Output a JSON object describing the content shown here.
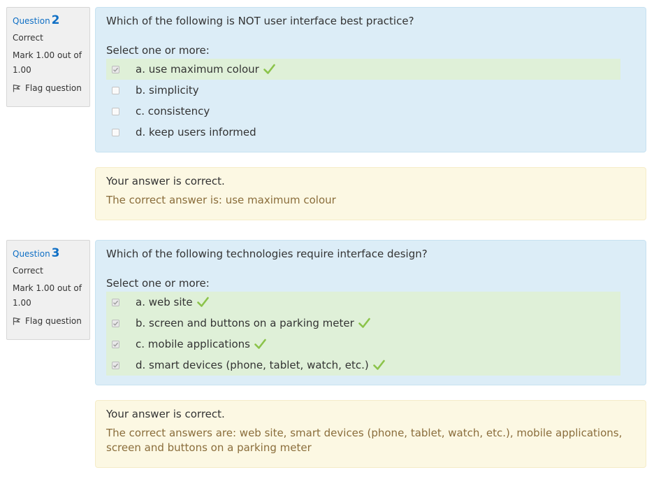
{
  "questions": [
    {
      "label": "Question",
      "number": "2",
      "state": "Correct",
      "grade": "Mark 1.00 out of 1.00",
      "flag_label": "Flag question",
      "text": "Which of the following is NOT user interface best practice?",
      "prompt": "Select one or more:",
      "answers": [
        {
          "label": "a. use maximum colour",
          "checked": true,
          "correct": true
        },
        {
          "label": "b. simplicity",
          "checked": false,
          "correct": false
        },
        {
          "label": "c. consistency",
          "checked": false,
          "correct": false
        },
        {
          "label": "d. keep users informed",
          "checked": false,
          "correct": false
        }
      ],
      "feedback": "Your answer is correct.",
      "right_answer": "The correct answer is: use maximum colour"
    },
    {
      "label": "Question",
      "number": "3",
      "state": "Correct",
      "grade": "Mark 1.00 out of 1.00",
      "flag_label": "Flag question",
      "text": "Which of the following technologies require interface design?",
      "prompt": "Select one or more:",
      "answers": [
        {
          "label": "a. web site",
          "checked": true,
          "correct": true
        },
        {
          "label": "b. screen and buttons on a parking meter",
          "checked": true,
          "correct": true
        },
        {
          "label": "c. mobile applications",
          "checked": true,
          "correct": true
        },
        {
          "label": "d. smart devices (phone, tablet, watch, etc.)",
          "checked": true,
          "correct": true
        }
      ],
      "feedback": "Your answer is correct.",
      "right_answer": "The correct answers are: web site, smart devices (phone, tablet, watch, etc.), mobile applications, screen and buttons on a parking meter"
    }
  ],
  "colors": {
    "accent": "#0f6fc5",
    "formulation_bg": "#dcedf7",
    "correct_bg": "#dff0d8",
    "feedback_bg": "#fcf8e3",
    "tick": "#8bc34a"
  },
  "icons": {
    "flag": "flag-icon",
    "tick": "checkmark-icon"
  }
}
